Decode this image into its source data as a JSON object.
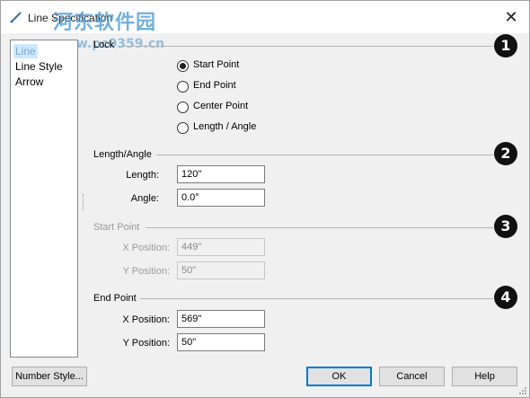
{
  "window": {
    "title": "Line Specification",
    "close_glyph": "✕"
  },
  "watermark": {
    "line1": "河东软件园",
    "line2": "www.pc0359.cn"
  },
  "sidebar": {
    "items": [
      {
        "label": "Line",
        "selected": true
      },
      {
        "label": "Line Style",
        "selected": false
      },
      {
        "label": "Arrow",
        "selected": false
      }
    ]
  },
  "lock": {
    "label": "Lock",
    "options": [
      {
        "label": "Start Point",
        "checked": true
      },
      {
        "label": "End Point",
        "checked": false
      },
      {
        "label": "Center Point",
        "checked": false
      },
      {
        "label": "Length / Angle",
        "checked": false
      }
    ]
  },
  "length_angle": {
    "label": "Length/Angle",
    "length_label": "Length:",
    "length_value": "120\"",
    "angle_label": "Angle:",
    "angle_value": "0.0°"
  },
  "start_point": {
    "label": "Start Point",
    "x_label": "X Position:",
    "x_value": "449\"",
    "y_label": "Y Position:",
    "y_value": "50\""
  },
  "end_point": {
    "label": "End Point",
    "x_label": "X Position:",
    "x_value": "569\"",
    "y_label": "Y Position:",
    "y_value": "50\""
  },
  "badges": [
    "1",
    "2",
    "3",
    "4"
  ],
  "buttons": {
    "number_style": "Number Style...",
    "ok": "OK",
    "cancel": "Cancel",
    "help": "Help"
  },
  "colors": {
    "badge": "#111111",
    "selection": "#cce8ff",
    "default_button_border": "#0078d7",
    "watermark": "#4696d2"
  }
}
